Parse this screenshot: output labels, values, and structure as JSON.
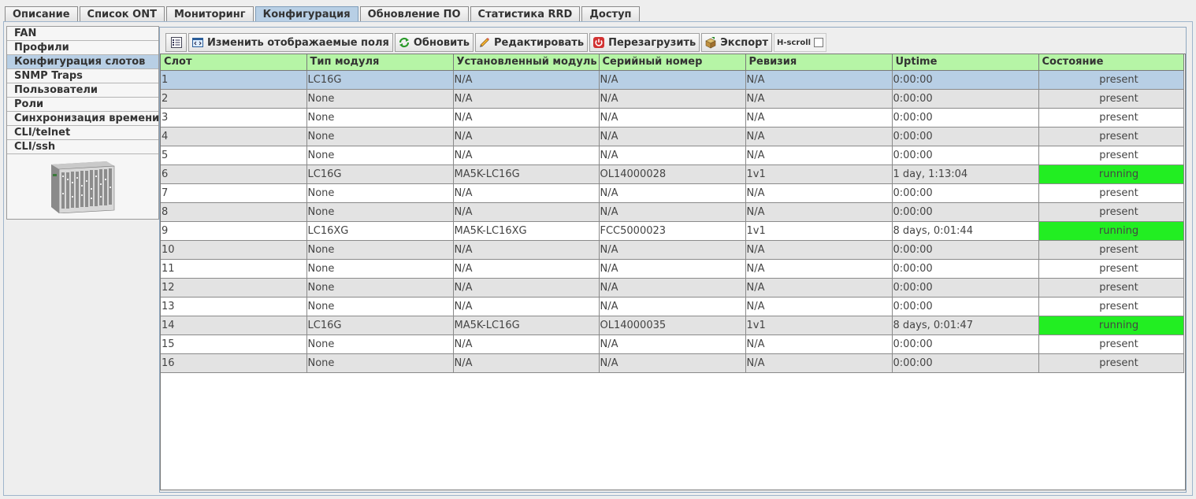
{
  "top_tabs": [
    {
      "label": "Описание"
    },
    {
      "label": "Список ONT"
    },
    {
      "label": "Мониторинг"
    },
    {
      "label": "Конфигурация",
      "active": true
    },
    {
      "label": "Обновление ПО"
    },
    {
      "label": "Статистика RRD"
    },
    {
      "label": "Доступ"
    }
  ],
  "left_nav": [
    {
      "label": "FAN"
    },
    {
      "label": "Профили"
    },
    {
      "label": "Конфигурация слотов",
      "active": true
    },
    {
      "label": "SNMP Traps"
    },
    {
      "label": "Пользователи"
    },
    {
      "label": "Роли"
    },
    {
      "label": "Синхронизация времени"
    },
    {
      "label": "CLI/telnet"
    },
    {
      "label": "CLI/ssh"
    }
  ],
  "toolbar": {
    "change_fields_label": "Изменить отображаемые поля",
    "refresh_label": "Обновить",
    "edit_label": "Редактировать",
    "reboot_label": "Перезагрузить",
    "export_label": "Экспорт",
    "hscroll_label": "H-scroll",
    "hscroll_checked": false
  },
  "table": {
    "columns": [
      "Слот",
      "Тип модуля",
      "Установленный модуль",
      "Серийный номер",
      "Ревизия",
      "Uptime",
      "Состояние"
    ],
    "selected_row": 0,
    "rows": [
      [
        "1",
        "LC16G",
        "N/A",
        "N/A",
        "N/A",
        "0:00:00",
        "present"
      ],
      [
        "2",
        "None",
        "N/A",
        "N/A",
        "N/A",
        "0:00:00",
        "present"
      ],
      [
        "3",
        "None",
        "N/A",
        "N/A",
        "N/A",
        "0:00:00",
        "present"
      ],
      [
        "4",
        "None",
        "N/A",
        "N/A",
        "N/A",
        "0:00:00",
        "present"
      ],
      [
        "5",
        "None",
        "N/A",
        "N/A",
        "N/A",
        "0:00:00",
        "present"
      ],
      [
        "6",
        "LC16G",
        "MA5K-LC16G",
        "OL14000028",
        "1v1",
        "1 day, 1:13:04",
        "running"
      ],
      [
        "7",
        "None",
        "N/A",
        "N/A",
        "N/A",
        "0:00:00",
        "present"
      ],
      [
        "8",
        "None",
        "N/A",
        "N/A",
        "N/A",
        "0:00:00",
        "present"
      ],
      [
        "9",
        "LC16XG",
        "MA5K-LC16XG",
        "FCC5000023",
        "1v1",
        "8 days, 0:01:44",
        "running"
      ],
      [
        "10",
        "None",
        "N/A",
        "N/A",
        "N/A",
        "0:00:00",
        "present"
      ],
      [
        "11",
        "None",
        "N/A",
        "N/A",
        "N/A",
        "0:00:00",
        "present"
      ],
      [
        "12",
        "None",
        "N/A",
        "N/A",
        "N/A",
        "0:00:00",
        "present"
      ],
      [
        "13",
        "None",
        "N/A",
        "N/A",
        "N/A",
        "0:00:00",
        "present"
      ],
      [
        "14",
        "LC16G",
        "MA5K-LC16G",
        "OL14000035",
        "1v1",
        "8 days, 0:01:47",
        "running"
      ],
      [
        "15",
        "None",
        "N/A",
        "N/A",
        "N/A",
        "0:00:00",
        "present"
      ],
      [
        "16",
        "None",
        "N/A",
        "N/A",
        "N/A",
        "0:00:00",
        "present"
      ]
    ]
  },
  "colors": {
    "header_bg": "#b6f5a6",
    "selected_bg": "#b8cfe5",
    "running_bg": "#22ee22",
    "even_row_bg": "#e3e3e3"
  }
}
